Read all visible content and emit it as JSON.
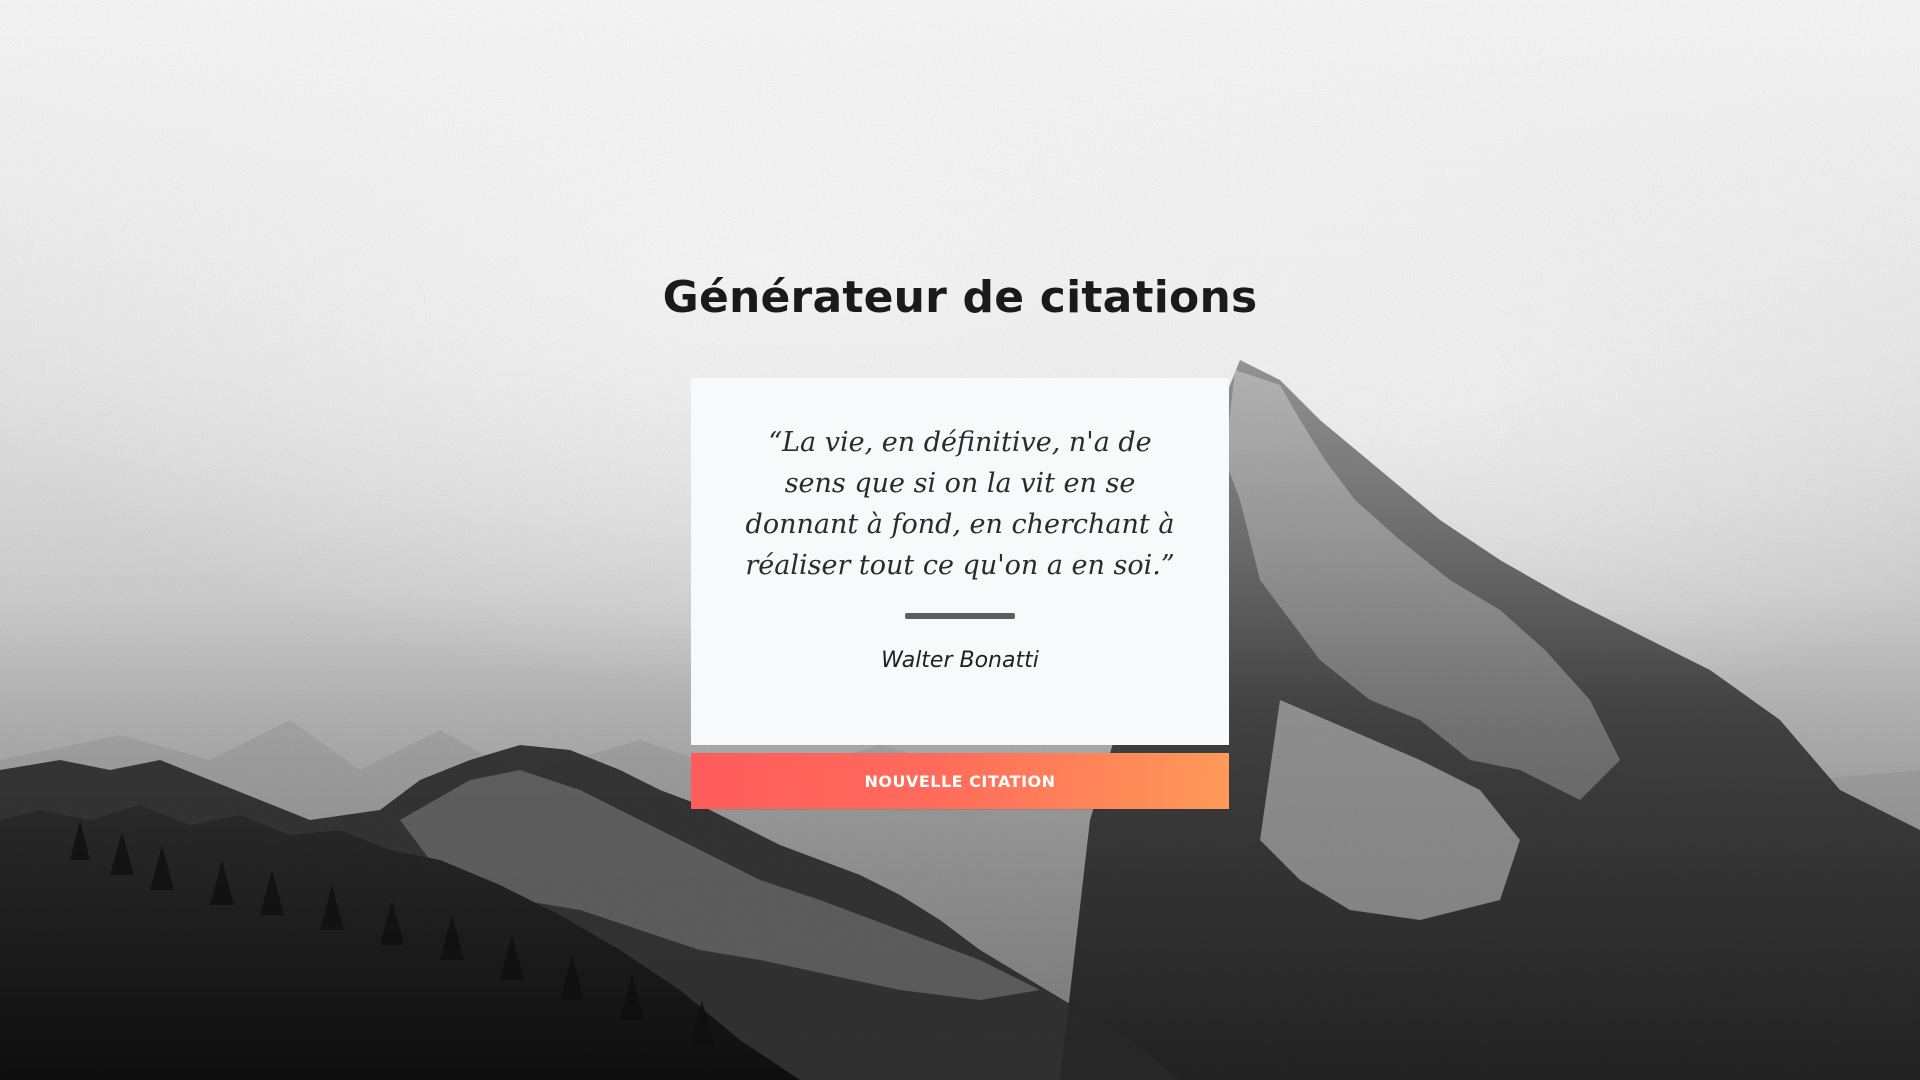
{
  "page": {
    "title": "Générateur de citations"
  },
  "quote_card": {
    "quote_text": "“La vie, en définitive, n'a de sens que si on la vit en se donnant à fond, en cherchant à réaliser tout ce qu'on a en soi.”",
    "author": "Walter Bonatti"
  },
  "actions": {
    "new_quote_button_label": "NOUVELLE CITATION"
  },
  "theme": {
    "button_gradient_start": "#ff5c5c",
    "button_gradient_end": "#ff9a58",
    "card_background": "#f8f9fb",
    "divider_color": "#5d5d5d"
  }
}
